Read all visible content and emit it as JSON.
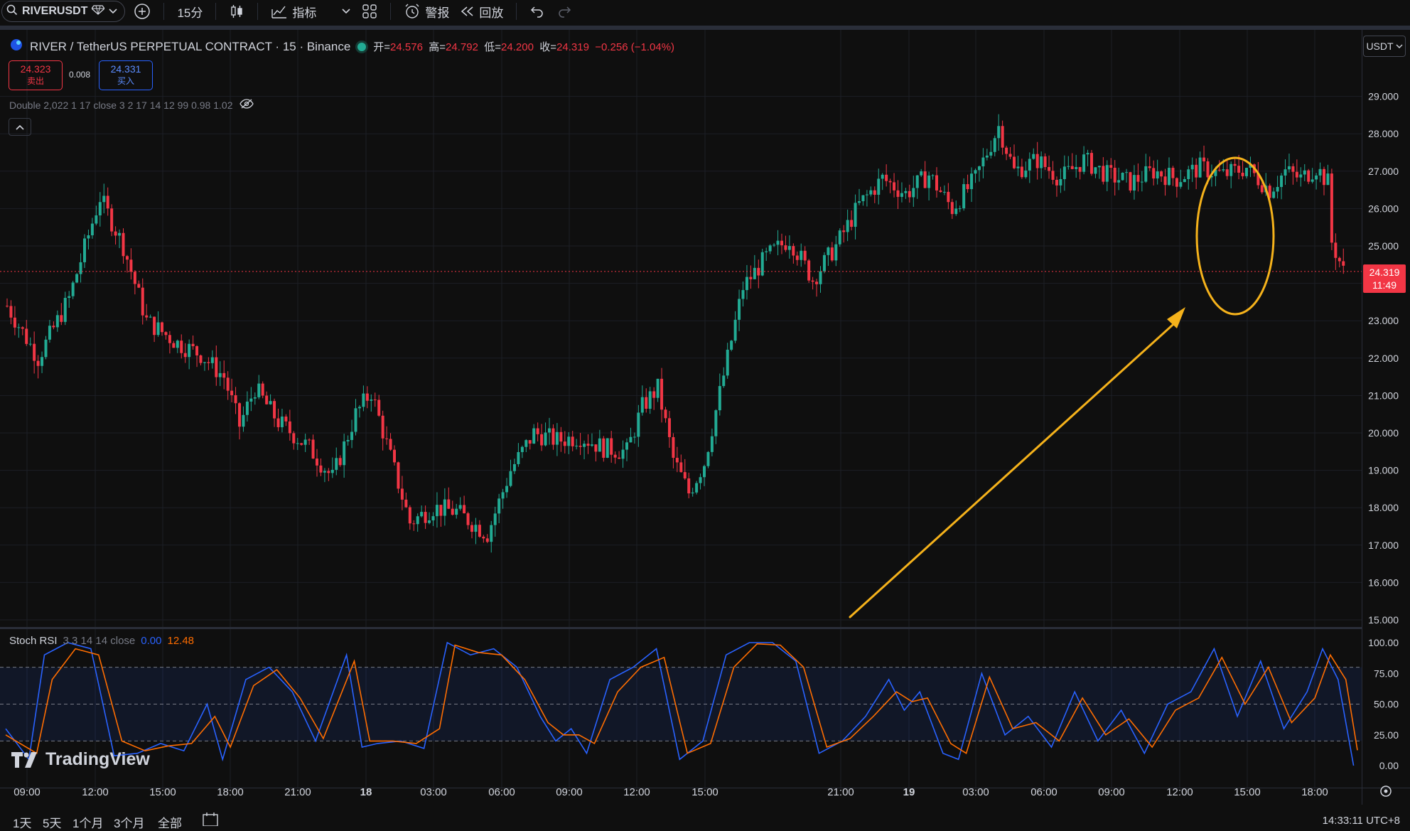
{
  "toolbar": {
    "symbol": "RIVERUSDT",
    "interval": "15分",
    "indicators_label": "指标",
    "alerts_label": "警报",
    "replay_label": "回放"
  },
  "legend": {
    "title": "RIVER / TetherUS PERPETUAL CONTRACT · 15 · Binance",
    "open_label": "开=",
    "open": "24.576",
    "high_label": "高=",
    "high": "24.792",
    "low_label": "低=",
    "low": "24.200",
    "close_label": "收=",
    "close": "24.319",
    "change": "−0.256 (−1.04%)"
  },
  "trade": {
    "sell_price": "24.323",
    "sell_label": "卖出",
    "spread": "0.008",
    "buy_price": "24.331",
    "buy_label": "买入"
  },
  "indicator": {
    "text": "Double 2,022 1 17 close 3 2 17 14 12 99 0.98 1.02"
  },
  "currency": "USDT",
  "last_price": {
    "price": "24.319",
    "countdown": "11:49"
  },
  "stoch": {
    "name": "Stoch RSI",
    "params": "3 3 14 14 close",
    "k": "0.00",
    "d": "12.48"
  },
  "brand": "TradingView",
  "ranges": [
    "1天",
    "5天",
    "1个月",
    "3个月",
    "全部"
  ],
  "clock": "14:33:11 UTC+8",
  "colors": {
    "up": "#22ab94",
    "down": "#f23645",
    "k_line": "#2962ff",
    "d_line": "#ff6d00",
    "annotation": "#f5b21b"
  },
  "chart_data": [
    {
      "type": "candlestick",
      "ylim": [
        15,
        30
      ],
      "y_ticks": [
        "15.000",
        "16.000",
        "17.000",
        "18.000",
        "19.000",
        "20.000",
        "21.000",
        "22.000",
        "23.000",
        "24.000",
        "25.000",
        "26.000",
        "27.000",
        "28.000",
        "29.000"
      ],
      "x_ticks": [
        "09:00",
        "12:00",
        "15:00",
        "18:00",
        "21:00",
        "18",
        "03:00",
        "06:00",
        "09:00",
        "12:00",
        "15:00",
        "21:00",
        "19",
        "03:00",
        "06:00",
        "09:00",
        "12:00",
        "15:00",
        "18:00"
      ],
      "price_path": [
        [
          0,
          23.4
        ],
        [
          8,
          22.0
        ],
        [
          16,
          23.6
        ],
        [
          24,
          26.3
        ],
        [
          30,
          25.0
        ],
        [
          36,
          23.0
        ],
        [
          44,
          22.4
        ],
        [
          50,
          22.1
        ],
        [
          56,
          21.5
        ],
        [
          60,
          20.2
        ],
        [
          64,
          21.2
        ],
        [
          70,
          20.3
        ],
        [
          78,
          19.6
        ],
        [
          84,
          18.8
        ],
        [
          90,
          20.5
        ],
        [
          94,
          21.1
        ],
        [
          100,
          19.0
        ],
        [
          104,
          17.6
        ],
        [
          110,
          18.0
        ],
        [
          116,
          17.9
        ],
        [
          120,
          17.6
        ],
        [
          124,
          17.3
        ],
        [
          130,
          19.0
        ],
        [
          136,
          20.0
        ],
        [
          142,
          19.8
        ],
        [
          148,
          19.9
        ],
        [
          154,
          19.6
        ],
        [
          160,
          19.5
        ],
        [
          164,
          20.7
        ],
        [
          168,
          21.2
        ],
        [
          172,
          19.3
        ],
        [
          176,
          18.4
        ],
        [
          180,
          19.2
        ],
        [
          186,
          22.0
        ],
        [
          190,
          23.9
        ],
        [
          196,
          24.7
        ],
        [
          202,
          25.2
        ],
        [
          208,
          24.1
        ],
        [
          214,
          25.0
        ],
        [
          220,
          26.1
        ],
        [
          226,
          26.8
        ],
        [
          232,
          26.4
        ],
        [
          238,
          26.9
        ],
        [
          244,
          26.0
        ],
        [
          250,
          26.8
        ],
        [
          256,
          28.2
        ],
        [
          260,
          27.0
        ],
        [
          266,
          27.3
        ],
        [
          272,
          26.8
        ],
        [
          278,
          27.3
        ],
        [
          284,
          26.9
        ],
        [
          290,
          26.7
        ],
        [
          296,
          27.0
        ],
        [
          302,
          26.8
        ],
        [
          308,
          27.1
        ],
        [
          314,
          26.9
        ],
        [
          320,
          27.1
        ],
        [
          326,
          26.5
        ],
        [
          330,
          27.0
        ],
        [
          334,
          26.8
        ],
        [
          338,
          27.1
        ],
        [
          341,
          26.7
        ],
        [
          342,
          25.1
        ],
        [
          344,
          24.6
        ],
        [
          345,
          24.32
        ]
      ],
      "annotation": "circle around final drop with arrow pointing to it"
    },
    {
      "type": "line",
      "title": "Stoch RSI",
      "ylim": [
        0,
        100
      ],
      "y_ticks": [
        "0.00",
        "25.00",
        "50.00",
        "75.00",
        "100.00"
      ],
      "bands": [
        20,
        50,
        80
      ],
      "series": [
        {
          "name": "K",
          "points": [
            [
              0,
              30
            ],
            [
              6,
              5
            ],
            [
              10,
              90
            ],
            [
              16,
              100
            ],
            [
              22,
              95
            ],
            [
              28,
              8
            ],
            [
              34,
              10
            ],
            [
              40,
              18
            ],
            [
              46,
              12
            ],
            [
              52,
              50
            ],
            [
              56,
              5
            ],
            [
              62,
              70
            ],
            [
              68,
              80
            ],
            [
              74,
              60
            ],
            [
              80,
              20
            ],
            [
              88,
              90
            ],
            [
              92,
              15
            ],
            [
              96,
              18
            ],
            [
              102,
              20
            ],
            [
              108,
              14
            ],
            [
              114,
              100
            ],
            [
              120,
              90
            ],
            [
              126,
              95
            ],
            [
              132,
              80
            ],
            [
              138,
              40
            ],
            [
              142,
              20
            ],
            [
              146,
              30
            ],
            [
              150,
              10
            ],
            [
              156,
              70
            ],
            [
              162,
              80
            ],
            [
              168,
              95
            ],
            [
              174,
              5
            ],
            [
              180,
              20
            ],
            [
              186,
              90
            ],
            [
              192,
              100
            ],
            [
              198,
              100
            ],
            [
              204,
              85
            ],
            [
              210,
              10
            ],
            [
              216,
              20
            ],
            [
              222,
              40
            ],
            [
              228,
              70
            ],
            [
              232,
              45
            ],
            [
              236,
              60
            ],
            [
              242,
              10
            ],
            [
              246,
              5
            ],
            [
              252,
              75
            ],
            [
              258,
              25
            ],
            [
              264,
              40
            ],
            [
              270,
              15
            ],
            [
              276,
              60
            ],
            [
              282,
              20
            ],
            [
              288,
              45
            ],
            [
              294,
              10
            ],
            [
              300,
              50
            ],
            [
              306,
              60
            ],
            [
              312,
              95
            ],
            [
              318,
              40
            ],
            [
              324,
              85
            ],
            [
              330,
              30
            ],
            [
              336,
              60
            ],
            [
              340,
              95
            ],
            [
              344,
              70
            ],
            [
              348,
              0
            ]
          ]
        },
        {
          "name": "D",
          "points": [
            [
              0,
              25
            ],
            [
              8,
              10
            ],
            [
              12,
              70
            ],
            [
              18,
              95
            ],
            [
              24,
              90
            ],
            [
              30,
              20
            ],
            [
              36,
              12
            ],
            [
              42,
              16
            ],
            [
              48,
              18
            ],
            [
              54,
              40
            ],
            [
              58,
              15
            ],
            [
              64,
              65
            ],
            [
              70,
              78
            ],
            [
              76,
              55
            ],
            [
              82,
              22
            ],
            [
              90,
              85
            ],
            [
              94,
              20
            ],
            [
              100,
              20
            ],
            [
              106,
              18
            ],
            [
              112,
              30
            ],
            [
              116,
              98
            ],
            [
              122,
              92
            ],
            [
              128,
              90
            ],
            [
              134,
              70
            ],
            [
              140,
              35
            ],
            [
              144,
              25
            ],
            [
              148,
              25
            ],
            [
              152,
              18
            ],
            [
              158,
              60
            ],
            [
              164,
              80
            ],
            [
              170,
              88
            ],
            [
              176,
              10
            ],
            [
              182,
              18
            ],
            [
              188,
              80
            ],
            [
              194,
              99
            ],
            [
              200,
              98
            ],
            [
              206,
              80
            ],
            [
              212,
              15
            ],
            [
              218,
              22
            ],
            [
              224,
              40
            ],
            [
              230,
              60
            ],
            [
              234,
              52
            ],
            [
              238,
              55
            ],
            [
              244,
              18
            ],
            [
              248,
              10
            ],
            [
              254,
              72
            ],
            [
              260,
              30
            ],
            [
              266,
              35
            ],
            [
              272,
              20
            ],
            [
              278,
              55
            ],
            [
              284,
              25
            ],
            [
              290,
              38
            ],
            [
              296,
              15
            ],
            [
              302,
              45
            ],
            [
              308,
              55
            ],
            [
              314,
              88
            ],
            [
              320,
              50
            ],
            [
              326,
              80
            ],
            [
              332,
              35
            ],
            [
              338,
              55
            ],
            [
              342,
              90
            ],
            [
              346,
              70
            ],
            [
              349,
              12.48
            ]
          ]
        }
      ]
    }
  ]
}
